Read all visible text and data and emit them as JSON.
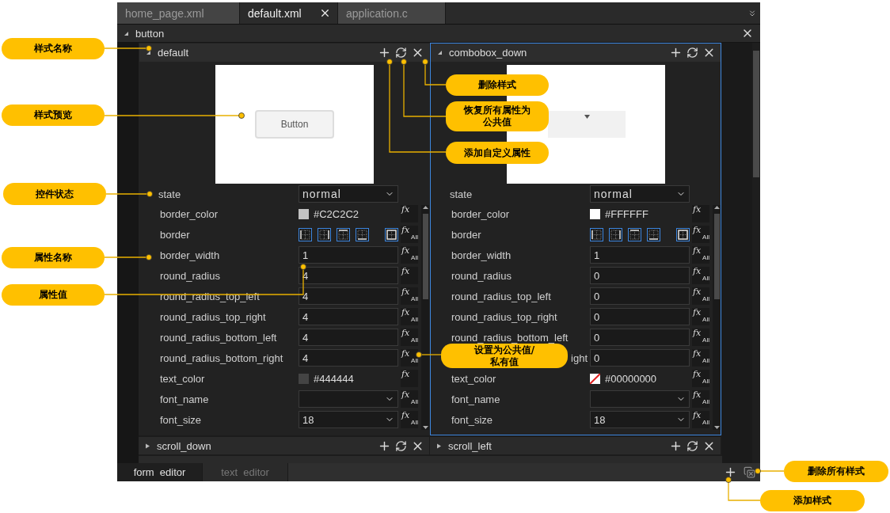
{
  "tabs": [
    {
      "label": "home_page.xml",
      "selected": false
    },
    {
      "label": "default.xml",
      "selected": true
    },
    {
      "label": "application.c",
      "selected": false
    }
  ],
  "group": {
    "title": "button",
    "expanded": true
  },
  "styles": [
    {
      "name": "default",
      "expanded": true,
      "focused": false,
      "preview": {
        "kind": "button",
        "text": "Button"
      },
      "state_label": "state",
      "state": "normal",
      "properties": [
        {
          "label": "border_color",
          "kind": "color",
          "value": "#C2C2C2",
          "transparent": false,
          "fx": {
            "label": "fx"
          }
        },
        {
          "label": "border",
          "kind": "border",
          "fx": {
            "label": "fx",
            "scope": "All"
          }
        },
        {
          "label": "border_width",
          "kind": "text",
          "value": "1",
          "fx": {
            "label": "fx",
            "scope": "All"
          }
        },
        {
          "label": "round_radius",
          "kind": "text",
          "value": "4",
          "fx": {
            "label": "fx"
          }
        },
        {
          "label": "round_radius_top_left",
          "kind": "text",
          "value": "4",
          "fx": {
            "label": "fx",
            "scope": "All"
          }
        },
        {
          "label": "round_radius_top_right",
          "kind": "text",
          "value": "4",
          "fx": {
            "label": "fx",
            "scope": "All"
          }
        },
        {
          "label": "round_radius_bottom_left",
          "kind": "text",
          "value": "4",
          "fx": {
            "label": "fx",
            "scope": "All"
          }
        },
        {
          "label": "round_radius_bottom_right",
          "kind": "text",
          "value": "4",
          "fx": {
            "label": "fx",
            "scope": "All"
          }
        },
        {
          "label": "text_color",
          "kind": "color",
          "value": "#444444",
          "transparent": false,
          "fx": {
            "label": "fx"
          }
        },
        {
          "label": "font_name",
          "kind": "select",
          "fx": {
            "label": "fx",
            "scope": "All"
          }
        },
        {
          "label": "font_size",
          "kind": "select",
          "value": "18",
          "fx": {
            "label": "fx",
            "scope": "All"
          }
        }
      ]
    },
    {
      "name": "combobox_down",
      "expanded": true,
      "focused": true,
      "preview": {
        "kind": "combobox"
      },
      "state_label": "state",
      "state": "normal",
      "properties": [
        {
          "label": "border_color",
          "kind": "color",
          "value": "#FFFFFF",
          "transparent": false,
          "fx": {
            "label": "fx"
          }
        },
        {
          "label": "border",
          "kind": "border",
          "fx": {
            "label": "fx",
            "scope": "All"
          }
        },
        {
          "label": "border_width",
          "kind": "text",
          "value": "1",
          "fx": {
            "label": "fx",
            "scope": "All"
          }
        },
        {
          "label": "round_radius",
          "kind": "text",
          "value": "0",
          "fx": {
            "label": "fx",
            "scope": "All"
          }
        },
        {
          "label": "round_radius_top_left",
          "kind": "text",
          "value": "0",
          "fx": {
            "label": "fx",
            "scope": "All"
          }
        },
        {
          "label": "round_radius_top_right",
          "kind": "text",
          "value": "0",
          "fx": {
            "label": "fx",
            "scope": "All"
          }
        },
        {
          "label": "round_radius_bottom_left",
          "kind": "text",
          "value": "0",
          "fx": {
            "label": "fx",
            "scope": "All"
          }
        },
        {
          "label": "ight",
          "kind": "text",
          "value": "0",
          "fx": {
            "label": "fx",
            "scope": "All"
          }
        },
        {
          "label": "text_color",
          "kind": "color",
          "value": "#00000000",
          "transparent": true,
          "fx": {
            "label": "fx",
            "scope": "All"
          }
        },
        {
          "label": "font_name",
          "kind": "select",
          "fx": {
            "label": "fx",
            "scope": "All"
          }
        },
        {
          "label": "font_size",
          "kind": "select",
          "value": "18",
          "fx": {
            "label": "fx",
            "scope": "All"
          }
        }
      ]
    }
  ],
  "collapsed_styles": [
    {
      "name": "scroll_down",
      "expanded": false
    },
    {
      "name": "scroll_left",
      "expanded": false
    }
  ],
  "bottom_tabs": [
    {
      "label": "form  editor",
      "selected": true
    },
    {
      "label": "text  editor",
      "selected": false
    }
  ],
  "callouts": [
    {
      "text": "样式名称"
    },
    {
      "text": "样式预览"
    },
    {
      "text": "控件状态"
    },
    {
      "text": "属性名称"
    },
    {
      "text": "属性值"
    },
    {
      "text": "删除样式"
    },
    {
      "text": "恢复所有属性为公共值"
    },
    {
      "text": "添加自定义属性"
    },
    {
      "text": "设置为公共值/私有值"
    },
    {
      "text": "删除所有样式"
    },
    {
      "text": "添加样式"
    }
  ]
}
